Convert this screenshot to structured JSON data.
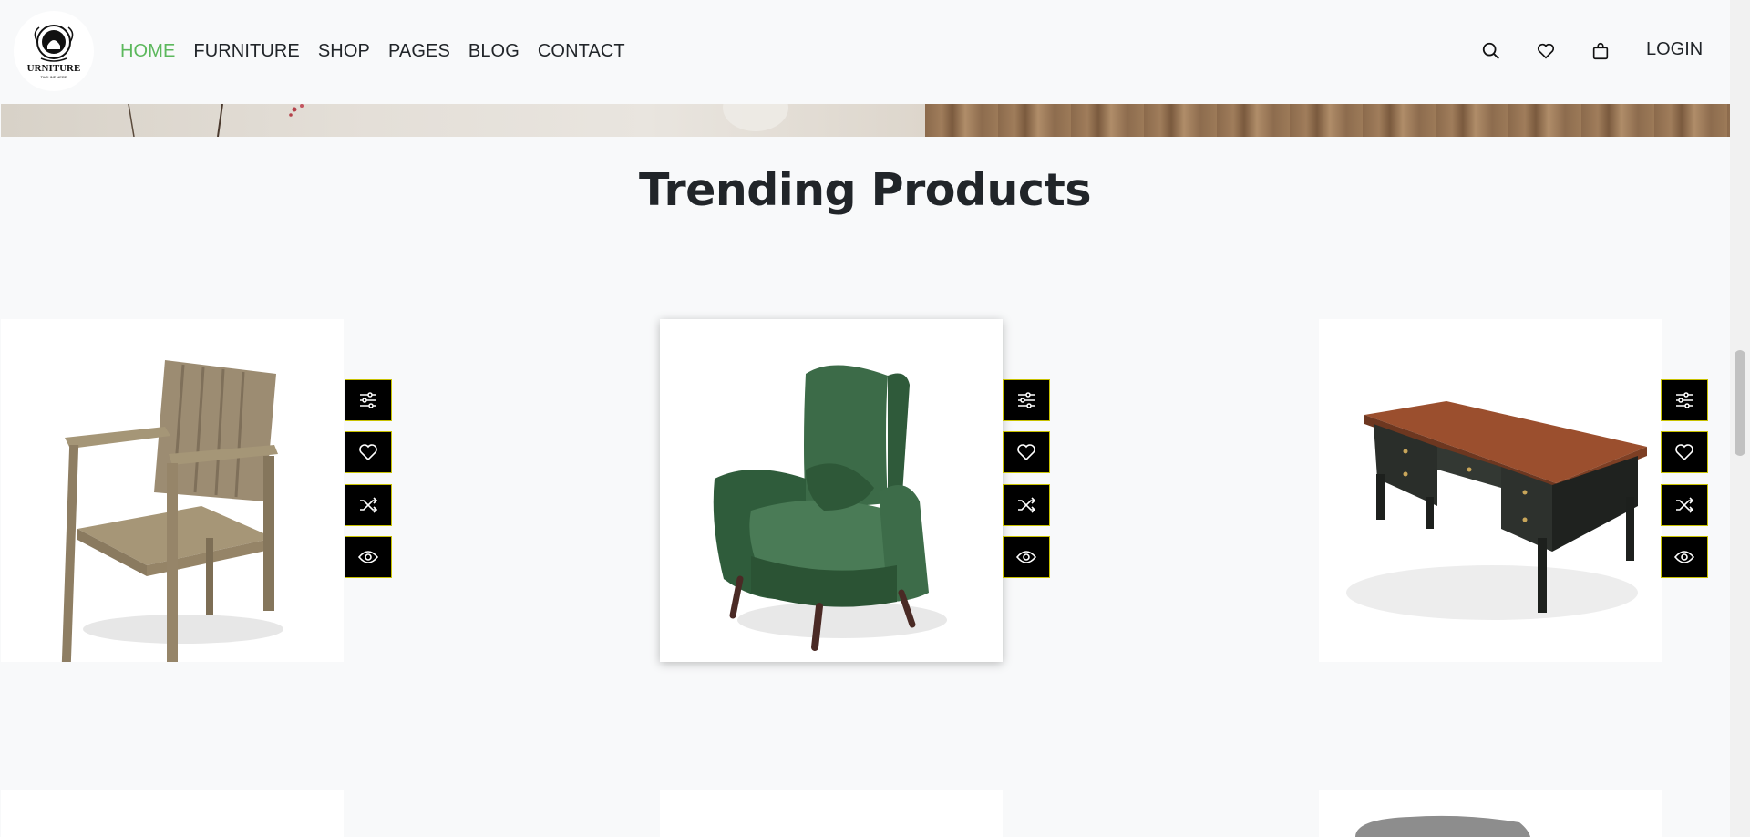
{
  "nav": {
    "logo_text": "URNITURE",
    "logo_tagline": "TAGLINE HERE",
    "items": [
      {
        "label": "HOME",
        "active": true
      },
      {
        "label": "FURNITURE",
        "active": false
      },
      {
        "label": "SHOP",
        "active": false
      },
      {
        "label": "PAGES",
        "active": false
      },
      {
        "label": "BLOG",
        "active": false
      },
      {
        "label": "CONTACT",
        "active": false
      }
    ],
    "icons": [
      "search-icon",
      "heart-icon",
      "shopping-bag-icon"
    ],
    "login_label": "LOGIN"
  },
  "section": {
    "title": "Trending Products"
  },
  "products": [
    {
      "name": "wooden-chair",
      "image": "wooden chair"
    },
    {
      "name": "green-wingback-armchair",
      "image": "green armchair",
      "featured": true
    },
    {
      "name": "wooden-desk",
      "image": "wooden desk"
    }
  ],
  "product_actions": [
    "sliders-icon",
    "heart-icon",
    "shuffle-icon",
    "eye-icon"
  ],
  "colors": {
    "accent": "#5cb85c",
    "text": "#212529",
    "action_bg": "#000000",
    "action_border": "#c9c200"
  }
}
